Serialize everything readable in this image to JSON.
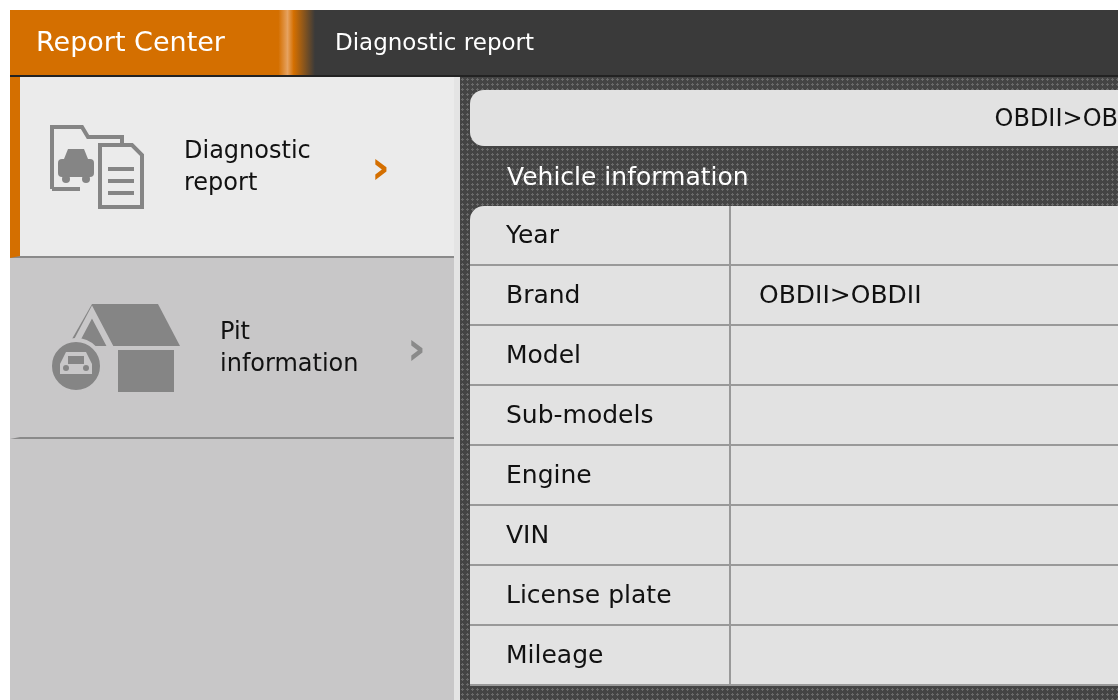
{
  "header": {
    "title": "Report Center",
    "subtitle": "Diagnostic report"
  },
  "sidebar": {
    "items": [
      {
        "kind": "report",
        "label": "Diagnostic report",
        "chevron": "›",
        "selected": true
      },
      {
        "kind": "garage",
        "label": "Pit information",
        "chevron": "›",
        "selected": false
      }
    ]
  },
  "path_bar": {
    "text": "OBDII>OB"
  },
  "section": {
    "title": "Vehicle information"
  },
  "table": {
    "rows": [
      {
        "label": "Year"
      },
      {
        "label": "Brand",
        "value": "OBDII>OBDII"
      },
      {
        "label": "Model"
      },
      {
        "label": "Sub-models"
      },
      {
        "label": "Engine"
      },
      {
        "label": "VIN"
      },
      {
        "label": "License plate"
      },
      {
        "label": "Mileage"
      }
    ]
  }
}
